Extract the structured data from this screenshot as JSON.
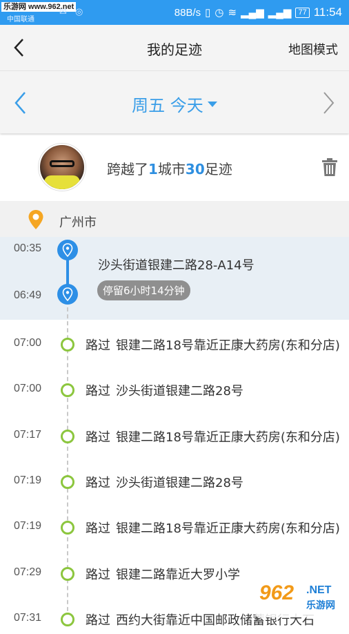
{
  "status_bar": {
    "watermark": "乐游网 www.962.net",
    "carrier": "中国联通",
    "speed": "88B/s",
    "battery": "77",
    "time": "11:54"
  },
  "appbar": {
    "title": "我的足迹",
    "map_mode": "地图模式"
  },
  "datebar": {
    "label": "周五 今天"
  },
  "summary": {
    "prefix": "跨越了",
    "city_count": "1",
    "mid": "城市",
    "footprint_count": "30",
    "suffix": "足迹"
  },
  "city": {
    "name": "广州市"
  },
  "stay": {
    "start_time": "00:35",
    "end_time": "06:49",
    "address": "沙头街道银建二路28-A14号",
    "duration": "停留6小时14分钟"
  },
  "timeline": [
    {
      "time": "07:00",
      "via": "路过",
      "place": "银建二路18号靠近正康大药房(东和分店)"
    },
    {
      "time": "07:00",
      "via": "路过",
      "place": "沙头街道银建二路28号"
    },
    {
      "time": "07:17",
      "via": "路过",
      "place": "银建二路18号靠近正康大药房(东和分店)"
    },
    {
      "time": "07:19",
      "via": "路过",
      "place": "沙头街道银建二路28号"
    },
    {
      "time": "07:19",
      "via": "路过",
      "place": "银建二路18号靠近正康大药房(东和分店)"
    },
    {
      "time": "07:29",
      "via": "路过",
      "place": "银建二路靠近大罗小学"
    },
    {
      "time": "07:31",
      "via": "路过",
      "place": "西约大街靠近中国邮政储蓄银行大石"
    }
  ],
  "logo": {
    "big": "962",
    "net": ".NET",
    "sub": "乐游网"
  },
  "colors": {
    "status_bar": "#2f9bf0",
    "accent": "#3a9ee8",
    "pin": "#2d8fe6",
    "dot": "#8cc63e",
    "city_pin": "#f5a623"
  }
}
